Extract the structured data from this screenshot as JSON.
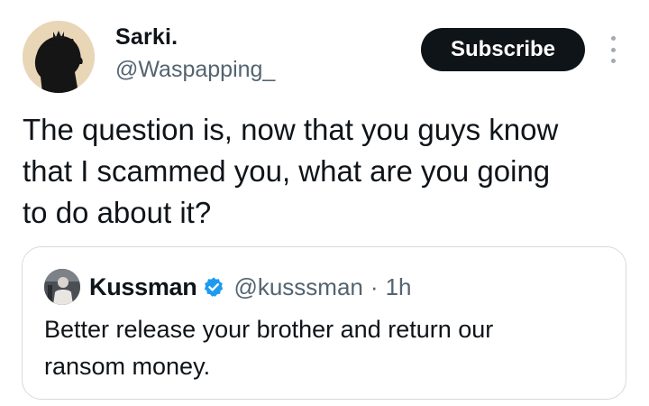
{
  "tweet": {
    "author": {
      "name": "Sarki.",
      "handle": "@Waspapping_",
      "avatar_icon": "silhouette-profile-avatar",
      "avatar_bg": "#e6d3b3"
    },
    "subscribe_label": "Subscribe",
    "more_icon": "more-vertical-icon",
    "text": "The question is, now that you guys know\nthat I scammed you, what are you going\nto do about it?"
  },
  "quote": {
    "author": {
      "name": "Kussman",
      "handle": "@kusssman",
      "time": "1h",
      "separator": "·",
      "verified": true,
      "verified_color": "#1d9bf0",
      "avatar_icon": "person-photo-avatar"
    },
    "text": "Better release your brother and return our\nransom money."
  },
  "colors": {
    "text": "#0f1419",
    "secondary": "#536471",
    "button_bg": "#0f1419",
    "border": "#d6dbdf"
  }
}
